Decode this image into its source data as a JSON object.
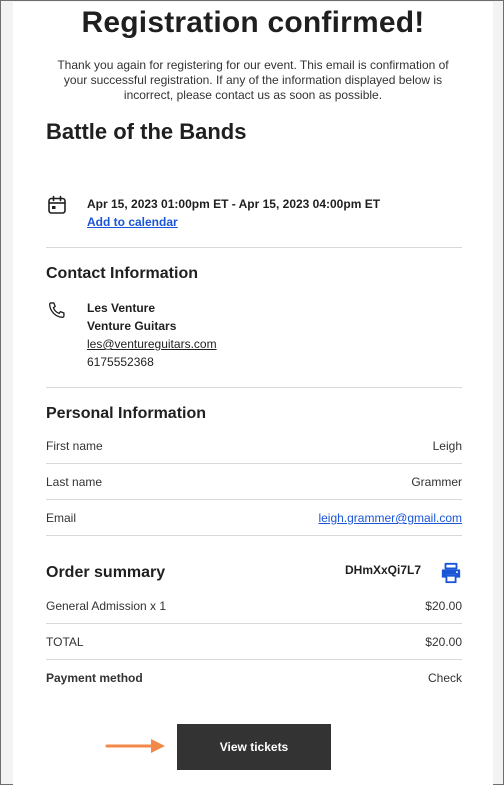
{
  "header": {
    "title": "Registration confirmed!",
    "intro": "Thank you again for registering for our event. This email is confirmation of your successful registration. If any of the information displayed below is incorrect, please contact us as soon as possible."
  },
  "event": {
    "name": "Battle of the Bands",
    "datetime": "Apr 15, 2023 01:00pm ET - Apr 15, 2023 04:00pm ET",
    "add_to_calendar": "Add to calendar",
    "calendar_icon": "calendar-icon"
  },
  "contact": {
    "title": "Contact Information",
    "icon": "phone-icon",
    "name": "Les Venture",
    "company": "Venture Guitars",
    "email": "les@ventureguitars.com",
    "phone": "6175552368"
  },
  "personal": {
    "title": "Personal Information",
    "rows": [
      {
        "label": "First name",
        "value": "Leigh"
      },
      {
        "label": "Last name",
        "value": "Grammer"
      },
      {
        "label": "Email",
        "value": "leigh.grammer@gmail.com"
      }
    ]
  },
  "order": {
    "title": "Order summary",
    "code": "DHmXxQi7L7",
    "print_icon": "printer-icon",
    "rows": [
      {
        "label": "General Admission x 1",
        "value": "$20.00"
      },
      {
        "label": "TOTAL",
        "value": "$20.00"
      },
      {
        "label": "Payment method",
        "value": "Check"
      }
    ]
  },
  "actions": {
    "view_tickets": "View tickets",
    "arrow_color": "#f0894a",
    "button_color": "#333333",
    "link_color": "#1a55d8"
  }
}
